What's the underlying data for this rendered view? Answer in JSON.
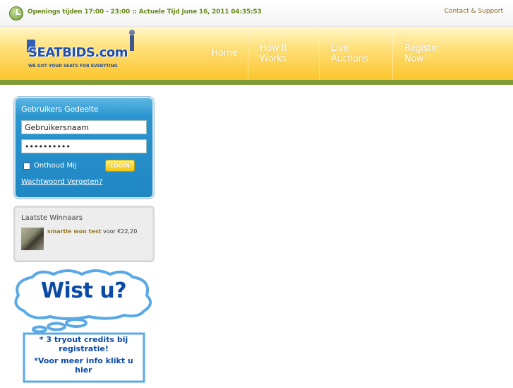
{
  "topbar": {
    "opening_label": "Openings tijden 17:00 - 23:00",
    "separator": "::",
    "time_label": "Actuele Tijd June 16, 2011 04:35:53",
    "contact_link": "Contact & Support"
  },
  "logo": {
    "name": "SEATBIDS.com",
    "tagline": "WE GOT YOUR SEATS FOR EVERYTING"
  },
  "nav": {
    "items": [
      {
        "label": "Home"
      },
      {
        "label": "How It Works"
      },
      {
        "label": "Live Auctions"
      },
      {
        "label": "Register Now!"
      }
    ]
  },
  "login": {
    "title": "Gebruikers Gedeelte",
    "username_value": "Gebruikersnaam",
    "password_value": "••••••••••",
    "remember_label": "Onthoud Mij",
    "login_button": "LOGIN",
    "forgot_link": "Wachtwoord Vergeten?"
  },
  "winners": {
    "title": "Laatste Winnaars",
    "items": [
      {
        "name": "smartie won test",
        "suffix": "voor €22,20"
      }
    ]
  },
  "promo": {
    "headline": "Wist u?",
    "line1": "* 3 tryout credits bij",
    "line2": "registratie!",
    "line3": "*Voor meer info klikt u",
    "line4": "hier"
  },
  "colors": {
    "accent_green": "#7f9b34",
    "header_yellow": "#fbc52c",
    "login_blue": "#1f87c3",
    "promo_blue": "#0b4aa6"
  }
}
